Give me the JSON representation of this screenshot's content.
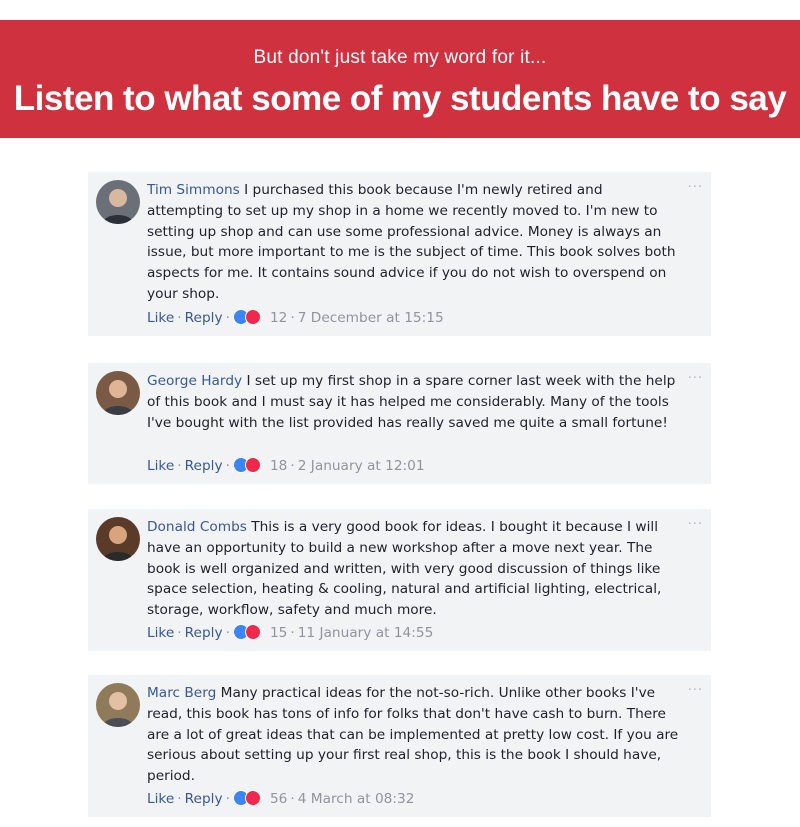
{
  "header": {
    "subtitle": "But don't just take my word for it...",
    "title": "Listen to what some of my students have to say"
  },
  "comments": [
    {
      "name": "Tim Simmons",
      "text": "I purchased this book because I'm newly retired and attempting to set up my shop in a home we recently moved to. I'm new to setting up shop and can use some professional advice. Money is always an issue, but more important to me is the subject of time. This book solves both aspects for me. It contains sound advice if you do not wish to overspend on your shop.",
      "like_label": "Like",
      "reply_label": "Reply",
      "reactions": "12",
      "date": "7 December at 15:15",
      "menu": "···",
      "avatar_color": "#6b6f78"
    },
    {
      "name": "George Hardy",
      "text": "I set up my first shop in a spare corner last week with the help of this book and I must say it has helped me considerably. Many of the tools I've bought with the list provided has really saved me quite a small fortune!",
      "like_label": "Like",
      "reply_label": "Reply",
      "reactions": "18",
      "date": "2 January at 12:01",
      "menu": "···",
      "avatar_color": "#7a5a44"
    },
    {
      "name": "Donald Combs",
      "text": "This is a very good book for ideas. I bought it because I will have an opportunity to build a new workshop after a move next year. The book is well organized and written, with very good discussion of things like space selection, heating & cooling, natural and artificial lighting, electrical, storage, workflow, safety and much more.",
      "like_label": "Like",
      "reply_label": "Reply",
      "reactions": "15",
      "date": "11 January at 14:55",
      "menu": "···",
      "avatar_color": "#5a3a28"
    },
    {
      "name": "Marc Berg",
      "text": "Many practical ideas for the not-so-rich. Unlike other books I've read, this book has tons of info for folks that don't have cash to burn. There are a lot of great ideas that can be implemented at pretty low cost. If you are serious about setting up your first real shop, this is the book I should have, period.",
      "like_label": "Like",
      "reply_label": "Reply",
      "reactions": "56",
      "date": "4 March at 08:32",
      "menu": "···",
      "avatar_color": "#8f7a5a"
    }
  ]
}
